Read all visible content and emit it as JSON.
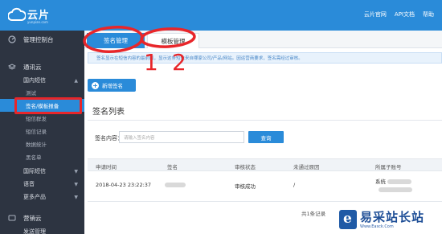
{
  "header": {
    "logo_text": "云片",
    "logo_sub": "yunpian.com",
    "links": [
      "云片官网",
      "API文档",
      "帮助"
    ]
  },
  "sidebar": {
    "console": "管理控制台",
    "section": "通讯云",
    "domestic_sms": "国内短信",
    "items": [
      "测试",
      "签名/模板报备",
      "短信群发",
      "短信记录",
      "数据统计",
      "黑名单"
    ],
    "intl_sms": "国际短信",
    "voice": "语音",
    "more": "更多产品",
    "marketing": "营销云",
    "bottom_item": "发送管理"
  },
  "tabs": {
    "signature": "签名管理",
    "template": "模板管理"
  },
  "info_text": "签名显示在短信内容的最前面，显示这条短信来自哪家公司/产品/网站。因运营商要求，签名需经过审核。",
  "add_button": "新增签名",
  "section_title": "签名列表",
  "search": {
    "label": "签名内容：",
    "placeholder": "请输入签名内容",
    "button": "查询"
  },
  "table": {
    "headers": [
      "申请时间",
      "签名",
      "审核状态",
      "未通过原因",
      "所属子账号"
    ],
    "rows": [
      {
        "time": "2018-04-23 23:22:37",
        "status": "审核成功",
        "reason": "/",
        "account": "系统"
      }
    ]
  },
  "pager": "共1条记录",
  "annotations": {
    "num1": "1",
    "num2": "2"
  },
  "watermark": {
    "text": "易采站长站",
    "sub": "Www.Easck.Com"
  },
  "colors": {
    "brand": "#2a8bd9",
    "sidebar": "#2d3441",
    "annotation": "#e8262a"
  }
}
